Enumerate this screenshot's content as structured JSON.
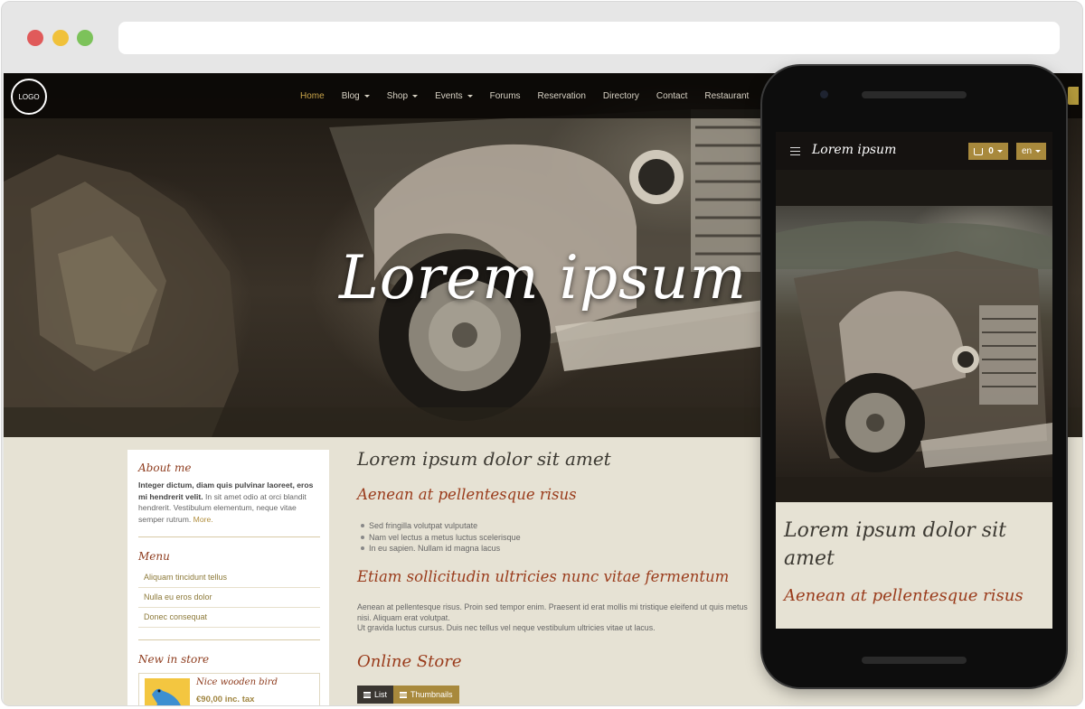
{
  "site": {
    "logo_text": "LOGO",
    "nav": [
      {
        "label": "Home",
        "active": true,
        "dropdown": false
      },
      {
        "label": "Blog",
        "active": false,
        "dropdown": true
      },
      {
        "label": "Shop",
        "active": false,
        "dropdown": true
      },
      {
        "label": "Events",
        "active": false,
        "dropdown": true
      },
      {
        "label": "Forums",
        "active": false,
        "dropdown": false
      },
      {
        "label": "Reservation",
        "active": false,
        "dropdown": false
      },
      {
        "label": "Directory",
        "active": false,
        "dropdown": false
      },
      {
        "label": "Contact",
        "active": false,
        "dropdown": false
      },
      {
        "label": "Restaurant",
        "active": false,
        "dropdown": false
      }
    ],
    "hero_title": "Lorem ipsum"
  },
  "sidebar": {
    "about_title": "About me",
    "about_bold": "Integer dictum, diam quis pulvinar laoreet, eros mi hendrerit velit.",
    "about_text": " In sit amet odio at orci blandit hendrerit. Vestibulum elementum, neque vitae semper rutrum.",
    "about_more": "More.",
    "menu_title": "Menu",
    "menu_items": [
      "Aliquam tincidunt tellus",
      "Nulla eu eros dolor",
      "Donec consequat"
    ],
    "store_title": "New in store",
    "product_name": "Nice wooden bird",
    "product_price": "€90,00 inc. tax"
  },
  "main": {
    "title": "Lorem ipsum dolor sit amet",
    "subtitle": "Aenean at pellentesque risus",
    "bullets": [
      "Sed fringilla volutpat vulputate",
      "Nam vel lectus a metus luctus scelerisque",
      "In eu sapien. Nullam id magna lacus"
    ],
    "section_title": "Etiam sollicitudin ultricies nunc vitae fermentum",
    "para_line1": "Aenean at pellentesque risus. Proin sed tempor enim. Praesent id erat mollis mi tristique eleifend ut quis metus",
    "para_line2": "nisi. Aliquam erat volutpat.",
    "para_line3": "Ut gravida luctus cursus. Duis nec tellus vel neque vestibulum ultricies vitae ut lacus.",
    "store_title": "Online Store",
    "view_list": "List",
    "view_thumbnails": "Thumbnails"
  },
  "mobile": {
    "brand": "Lorem ipsum",
    "cart_count": "0",
    "lang": "en",
    "title": "Lorem ipsum dolor sit amet",
    "subtitle": "Aenean at pellentesque risus"
  },
  "colors": {
    "accent_gold": "#a8893c",
    "heading_red": "#9a3c1c",
    "content_bg": "#e6e2d4"
  }
}
